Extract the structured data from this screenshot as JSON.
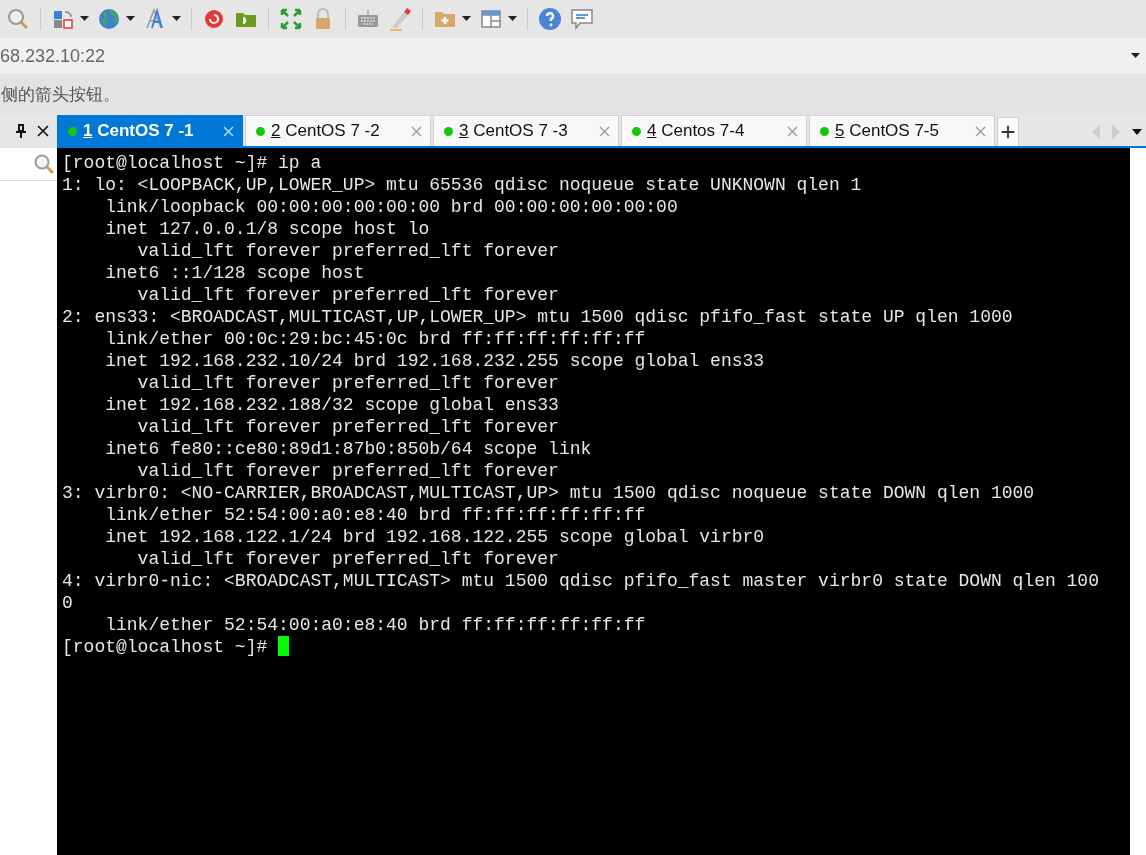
{
  "address_bar": {
    "value": "68.232.10:22"
  },
  "hint_bar": {
    "text": "侧的箭头按钮。"
  },
  "tabs": [
    {
      "number": "1",
      "label": "CentOS 7 -1",
      "selected": true,
      "connected": true
    },
    {
      "number": "2",
      "label": "CentOS 7 -2",
      "selected": false,
      "connected": true
    },
    {
      "number": "3",
      "label": "CentOS 7 -3",
      "selected": false,
      "connected": true
    },
    {
      "number": "4",
      "label": "Centos 7-4",
      "selected": false,
      "connected": true
    },
    {
      "number": "5",
      "label": "CentOS 7-5",
      "selected": false,
      "connected": true
    }
  ],
  "terminal": {
    "lines": [
      "[root@localhost ~]# ip a",
      "1: lo: <LOOPBACK,UP,LOWER_UP> mtu 65536 qdisc noqueue state UNKNOWN qlen 1",
      "    link/loopback 00:00:00:00:00:00 brd 00:00:00:00:00:00",
      "    inet 127.0.0.1/8 scope host lo",
      "       valid_lft forever preferred_lft forever",
      "    inet6 ::1/128 scope host",
      "       valid_lft forever preferred_lft forever",
      "2: ens33: <BROADCAST,MULTICAST,UP,LOWER_UP> mtu 1500 qdisc pfifo_fast state UP qlen 1000",
      "    link/ether 00:0c:29:bc:45:0c brd ff:ff:ff:ff:ff:ff",
      "    inet 192.168.232.10/24 brd 192.168.232.255 scope global ens33",
      "       valid_lft forever preferred_lft forever",
      "    inet 192.168.232.188/32 scope global ens33",
      "       valid_lft forever preferred_lft forever",
      "    inet6 fe80::ce80:89d1:87b0:850b/64 scope link",
      "       valid_lft forever preferred_lft forever",
      "3: virbr0: <NO-CARRIER,BROADCAST,MULTICAST,UP> mtu 1500 qdisc noqueue state DOWN qlen 1000",
      "    link/ether 52:54:00:a0:e8:40 brd ff:ff:ff:ff:ff:ff",
      "    inet 192.168.122.1/24 brd 192.168.122.255 scope global virbr0",
      "       valid_lft forever preferred_lft forever",
      "4: virbr0-nic: <BROADCAST,MULTICAST> mtu 1500 qdisc pfifo_fast master virbr0 state DOWN qlen 100",
      "0",
      "    link/ether 52:54:00:a0:e8:40 brd ff:ff:ff:ff:ff:ff"
    ],
    "prompt": "[root@localhost ~]# ",
    "cursor_visible": true
  }
}
